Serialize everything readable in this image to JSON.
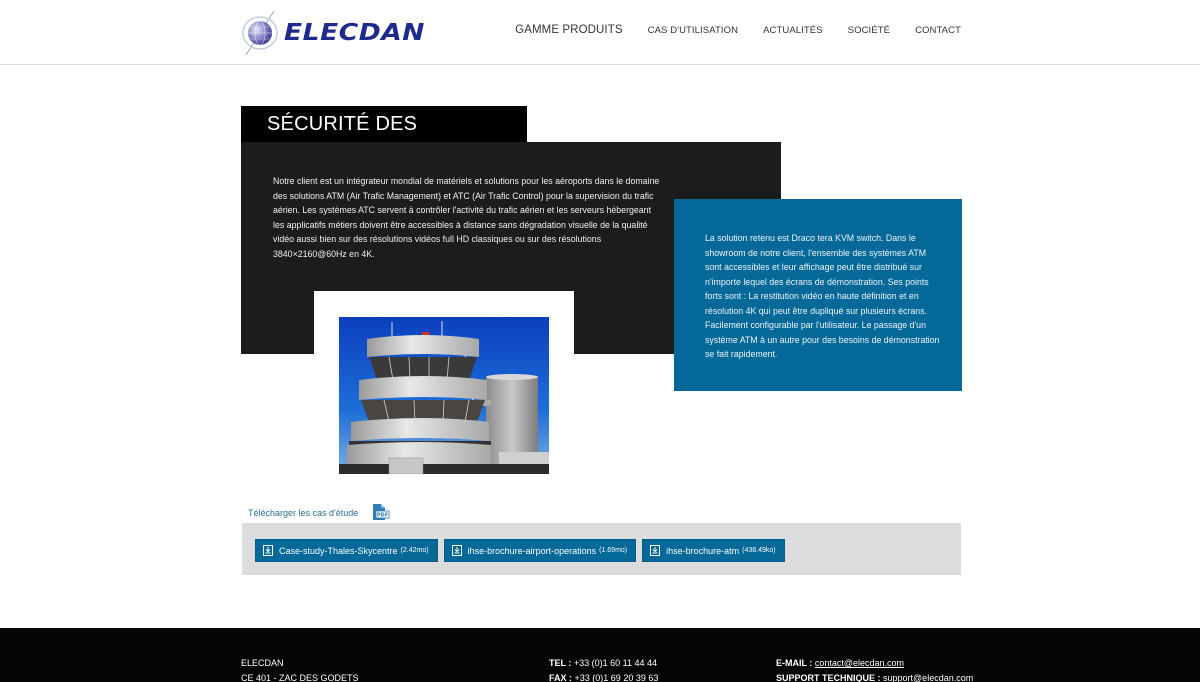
{
  "header": {
    "logo_text": "ELECDAN",
    "nav": [
      {
        "label": "GAMME PRODUITS"
      },
      {
        "label": "CAS D'UTILISATION"
      },
      {
        "label": "ACTUALITÉS"
      },
      {
        "label": "SOCIÉTÉ"
      },
      {
        "label": "CONTACT"
      }
    ]
  },
  "main": {
    "title": "SÉCURITÉ DES AÉROPORTS",
    "intro_text": "Notre client est un intégrateur mondial de matériels et solutions pour les aéroports dans le domaine des solutions ATM (Air Trafic Management) et ATC (Air Trafic Control) pour la supervision du trafic aérien. Les systèmes ATC servent à contrôler l'activité du trafic aérien et les serveurs hébergeant les applicatifs métiers doivent être accessibles à distance sans dégradation visuelle de la qualité vidéo aussi bien sur des résolutions vidéos full HD classiques ou sur des résolutions 3840×2160@60Hz en 4K.",
    "solution_text": "La solution retenu est Draco tera KVM switch. Dans le showroom de notre client, l'ensemble des systèmes ATM sont accessibles et leur affichage peut être distribué sur n'importe lequel des écrans de démonstration. Ses points forts sont : La restitution vidéo en haute définition et en résolution 4K qui peut être dupliqué sur plusieurs écrans. Facilement configurable par l'utilisateur. Le passage d'un système ATM à un autre pour des besoins de démonstration se fait rapidement.",
    "image_alt": "Airport control tower",
    "download_label": "Télécharger les cas d'étude",
    "downloads": [
      {
        "name": "Case-study-Thales-Skycentre",
        "size": "(2.42mo)"
      },
      {
        "name": "ihse-brochure-airport-operations",
        "size": "(1.69mo)"
      },
      {
        "name": "ihse-brochure-atm",
        "size": "(438.49ko)"
      }
    ]
  },
  "footer": {
    "company": "ELECDAN",
    "address": "CE 401 - ZAC DES GODETS",
    "tel_label": "TEL :",
    "tel": "+33 (0)1 60 11 44 44",
    "fax_label": "FAX :",
    "fax": "+33 (0)1 69 20 39 63",
    "email_label": "E-MAIL :",
    "email": "contact@elecdan.com",
    "support_label": "SUPPORT TECHNIQUE :",
    "support_email": "support@elecdan.com"
  },
  "colors": {
    "brand_blue": "#046898",
    "logo_navy": "#1e2a8c",
    "dark_panel": "#1c1c1c",
    "link_blue": "#2d6d95"
  }
}
